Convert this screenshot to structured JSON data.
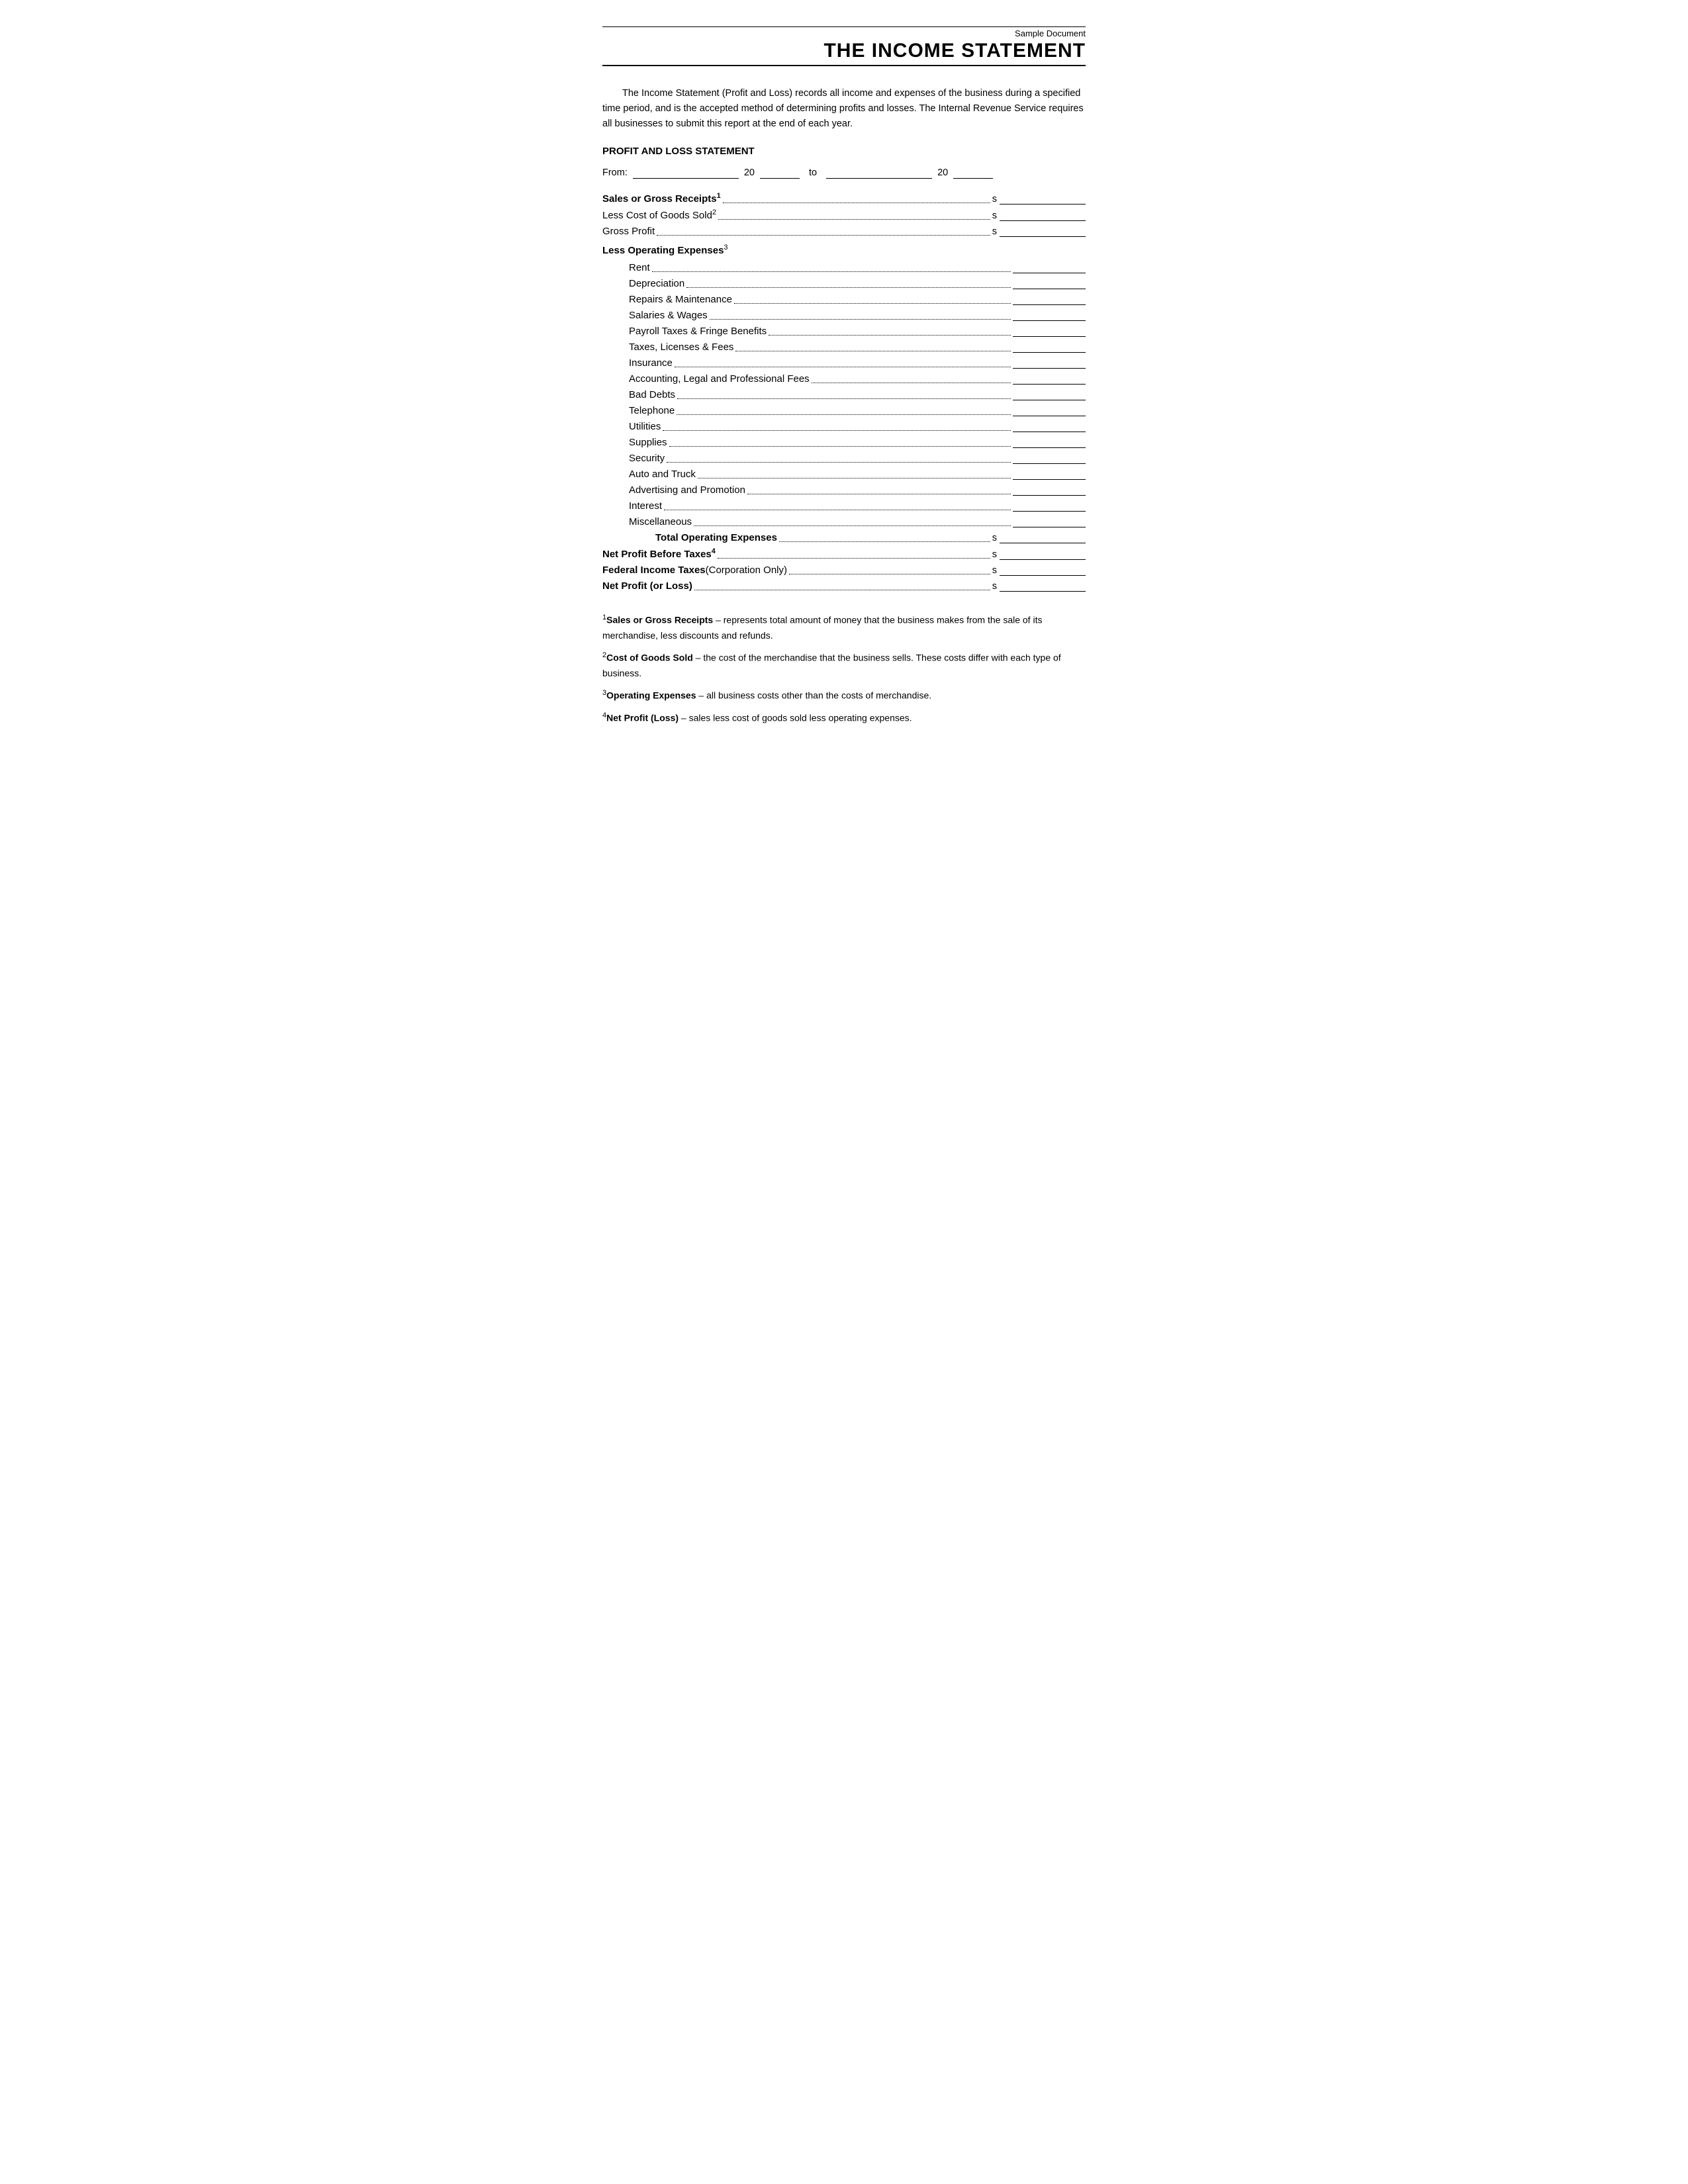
{
  "header": {
    "sample_label": "Sample Document",
    "title": "THE INCOME STATEMENT"
  },
  "intro": {
    "text": "The Income Statement (Profit and Loss) records all income and expenses of the business during a specified time period, and is the accepted method of determining profits and losses. The Internal Revenue Service requires all businesses to submit this report at the end of each year."
  },
  "section_title": "PROFIT AND LOSS STATEMENT",
  "from_to": {
    "from_label": "From:",
    "year1_label": "20",
    "to_label": "to",
    "year2_label": "20"
  },
  "main_rows": [
    {
      "label": "Sales or Gross Receipts",
      "sup": "1",
      "dollar": "s"
    },
    {
      "label": "Less Cost of Goods Sold",
      "sup": "2",
      "dollar": "s"
    },
    {
      "label": "Gross Profit",
      "sup": "",
      "dollar": "s"
    }
  ],
  "less_operating_label": "Less Operating Expenses",
  "less_operating_sup": "3",
  "expense_rows": [
    "Rent",
    "Depreciation",
    "Repairs & Maintenance",
    "Salaries & Wages",
    "Payroll Taxes & Fringe Benefits",
    "Taxes, Licenses & Fees",
    "Insurance",
    "Accounting, Legal and Professional Fees",
    "Bad Debts",
    "Telephone",
    "Utilities",
    "Supplies",
    "Security",
    "Auto and Truck",
    "Advertising and Promotion",
    "Interest",
    "Miscellaneous"
  ],
  "total_operating_label": "Total Operating Expenses",
  "total_operating_dollar": "s",
  "bottom_rows": [
    {
      "label": "Net Profit Before Taxes",
      "sup": "4",
      "bold": true,
      "dollar": "s"
    },
    {
      "label": "Federal Income Taxes",
      "sup": "",
      "bold": true,
      "extra": " (Corporation Only)",
      "dollar": "s"
    },
    {
      "label": "Net Profit (or Loss)",
      "sup": "",
      "bold": true,
      "dollar": "s"
    }
  ],
  "footnotes": [
    {
      "num": "1",
      "bold_part": "Sales or Gross Receipts",
      "rest": " – represents total amount of money that the business makes from the sale of its merchandise, less discounts and refunds."
    },
    {
      "num": "2",
      "bold_part": "Cost of Goods Sold",
      "rest": " – the cost of the merchandise that the business sells. These costs differ with each type of business."
    },
    {
      "num": "3",
      "bold_part": "Operating Expenses",
      "rest": " – all business costs other than the costs of merchandise."
    },
    {
      "num": "4",
      "bold_part": "Net Profit (Loss)",
      "rest": " – sales less cost of goods sold less operating expenses."
    }
  ]
}
